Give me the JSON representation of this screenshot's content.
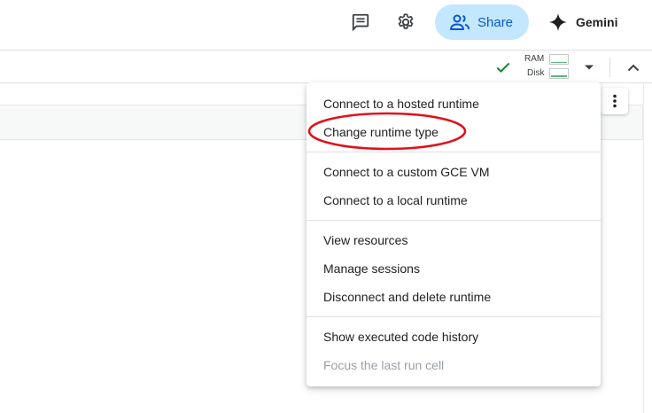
{
  "header": {
    "share_label": "Share",
    "gemini_label": "Gemini"
  },
  "toolbar": {
    "ram_label": "RAM",
    "disk_label": "Disk"
  },
  "runtime_menu": {
    "items": [
      {
        "label": "Connect to a hosted runtime",
        "enabled": true
      },
      {
        "label": "Change runtime type",
        "enabled": true
      },
      {
        "label": "Connect to a custom GCE VM",
        "enabled": true
      },
      {
        "label": "Connect to a local runtime",
        "enabled": true
      },
      {
        "label": "View resources",
        "enabled": true
      },
      {
        "label": "Manage sessions",
        "enabled": true
      },
      {
        "label": "Disconnect and delete runtime",
        "enabled": true
      },
      {
        "label": "Show executed code history",
        "enabled": true
      },
      {
        "label": "Focus the last run cell",
        "enabled": false
      }
    ]
  },
  "colors": {
    "share_bg": "#c2e7ff",
    "share_text": "#0b57d0",
    "check_green": "#188038",
    "annotation_red": "#e0101a"
  },
  "icons": {
    "comments": "comments-icon",
    "settings": "gear-icon",
    "share": "people-icon",
    "gemini": "sparkle-icon",
    "status": "check-icon",
    "dropdown": "caret-down-icon",
    "collapse": "chevron-up-icon",
    "more": "more-vert-icon"
  }
}
